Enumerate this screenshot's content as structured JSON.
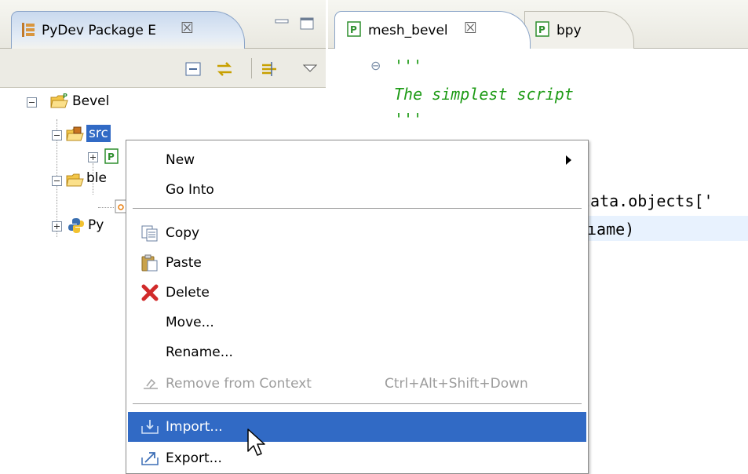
{
  "left_view": {
    "tab_title": "PyDev Package E",
    "close_symbol": "☒",
    "tree": {
      "root": "Bevel",
      "src": "src",
      "src_child_partial": "",
      "blender_partial": "ble",
      "python_partial": "Py"
    }
  },
  "editor": {
    "tabs": [
      {
        "label": "mesh_bevel",
        "close": "☒",
        "active": true
      },
      {
        "label": "bpy",
        "active": false
      }
    ],
    "code_lines": [
      "'''",
      "The simplest script",
      "'''",
      "lata.objects['",
      "ıame)"
    ],
    "collapse_symbol": "⊖"
  },
  "context_menu": {
    "items": [
      {
        "label": "New",
        "has_submenu": true
      },
      {
        "label": "Go Into"
      },
      {
        "label": "Copy",
        "icon": "copy-icon"
      },
      {
        "label": "Paste",
        "icon": "paste-icon"
      },
      {
        "label": "Delete",
        "icon": "delete-icon"
      },
      {
        "label": "Move..."
      },
      {
        "label": "Rename..."
      },
      {
        "label": "Remove from Context",
        "accelerator": "Ctrl+Alt+Shift+Down",
        "disabled": true,
        "icon": "remove-context-icon"
      },
      {
        "label": "Import...",
        "icon": "import-icon",
        "highlighted": true
      },
      {
        "label": "Export...",
        "icon": "export-icon"
      }
    ]
  },
  "colors": {
    "selection": "#316ac5",
    "docstring": "#1e9b16",
    "current_line": "#e8f2fe"
  }
}
